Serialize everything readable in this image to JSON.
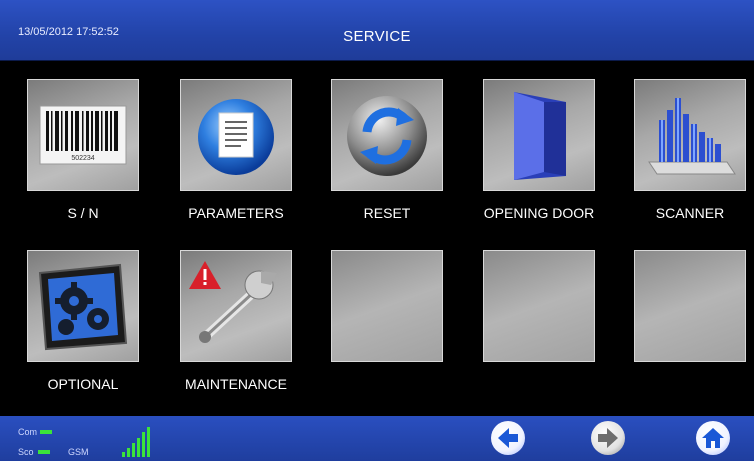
{
  "header": {
    "datetime": "13/05/2012 17:52:52",
    "title": "SERVICE"
  },
  "tiles": [
    {
      "label": "S / N",
      "icon": "barcode-icon",
      "barcode_number": "502234"
    },
    {
      "label": "PARAMETERS",
      "icon": "document-icon"
    },
    {
      "label": "RESET",
      "icon": "refresh-icon"
    },
    {
      "label": "OPENING DOOR",
      "icon": "door-icon"
    },
    {
      "label": "SCANNER",
      "icon": "scanner-icon"
    },
    {
      "label": "OPTIONAL",
      "icon": "gears-icon"
    },
    {
      "label": "MAINTENANCE",
      "icon": "wrench-warning-icon"
    },
    {
      "label": "",
      "icon": ""
    },
    {
      "label": "",
      "icon": ""
    },
    {
      "label": "",
      "icon": ""
    }
  ],
  "footer": {
    "com_label": "Com",
    "sco_label": "Sco",
    "gsm_label": "GSM",
    "nav": [
      "back-arrow-icon",
      "forward-arrow-icon",
      "home-icon"
    ]
  },
  "colors": {
    "header_blue": "#2446b0",
    "status_green": "#3be33b",
    "nav_blue": "#1a58d6"
  }
}
